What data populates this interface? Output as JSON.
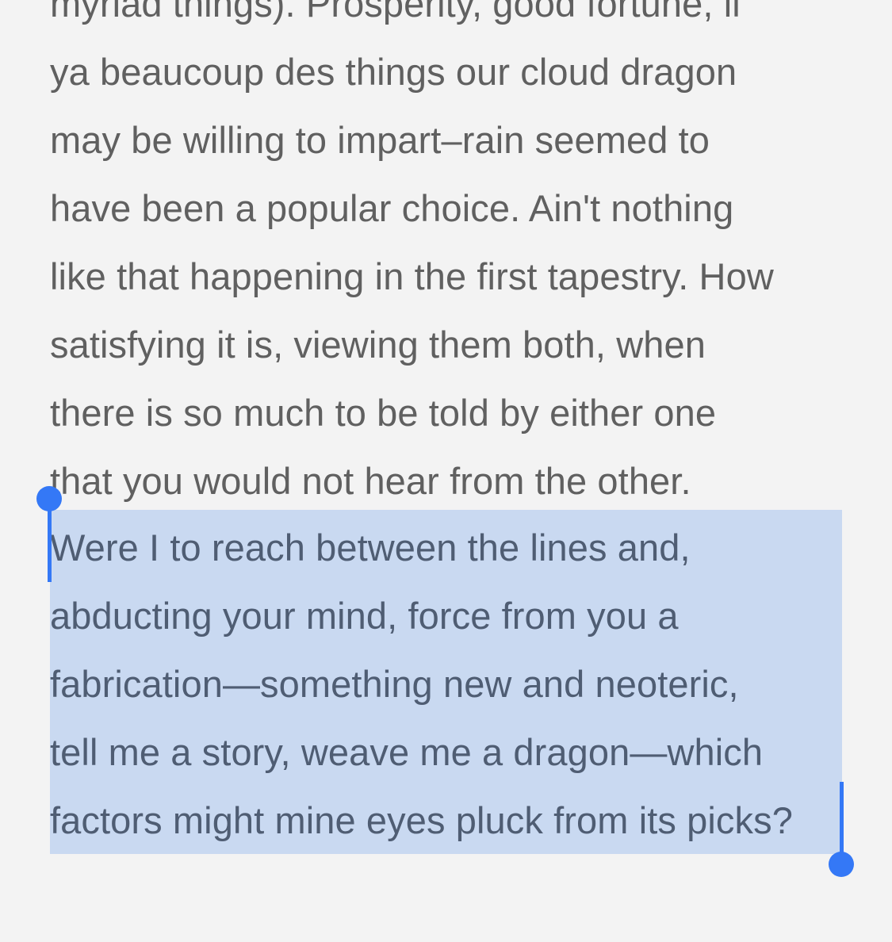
{
  "reader": {
    "lines": [
      "myriad things). Prosperity, good fortune, il",
      "ya beaucoup des things our cloud dragon",
      "may be willing to impart–rain seemed to",
      "have been a popular choice. Ain't nothing",
      "like that happening in the first tapestry. How",
      "satisfying it is, viewing them both, when",
      "there is so much to be told by either one",
      "that you would not hear from the other."
    ],
    "selected_lines": [
      "Were I to reach between the lines and,",
      "abducting your mind, force from you a",
      "fabrication—something new and neoteric,",
      "tell me a story, weave me a dragon—which",
      "factors might mine eyes pluck from its picks?"
    ]
  },
  "colors": {
    "background": "#f3f3f3",
    "text": "#606060",
    "selection_highlight": "#c9d9f1",
    "selection_text": "#4f5d73",
    "selection_handle": "#3478f6"
  }
}
